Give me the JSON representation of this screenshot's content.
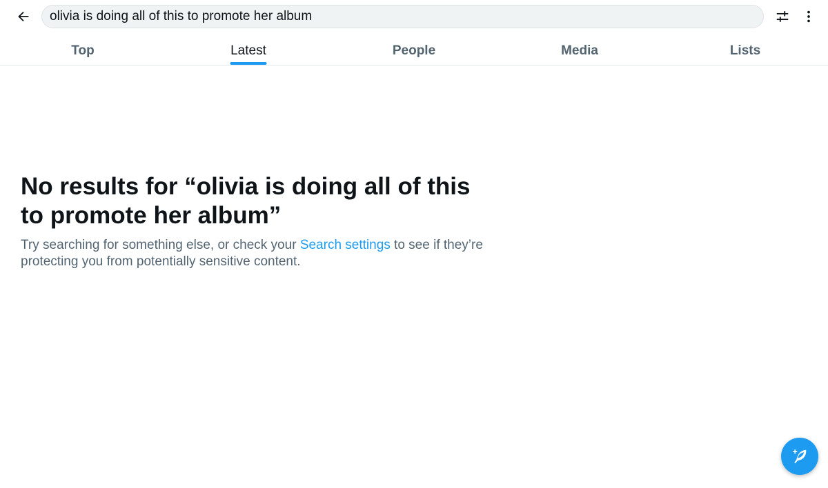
{
  "search": {
    "query": "olivia is doing all of this to promote her album"
  },
  "tabs": [
    {
      "label": "Top",
      "active": false
    },
    {
      "label": "Latest",
      "active": true
    },
    {
      "label": "People",
      "active": false
    },
    {
      "label": "Media",
      "active": false
    },
    {
      "label": "Lists",
      "active": false
    }
  ],
  "empty_state": {
    "title": "No results for “olivia is doing all of this to promote her album”",
    "body_before": "Try searching for something else, or check your ",
    "link_text": "Search settings",
    "body_after": " to see if they’re protecting you from potentially sensitive content."
  },
  "icons": {
    "back": "back-arrow-icon",
    "filter": "sliders-icon",
    "more": "more-vertical-icon",
    "compose": "compose-feather-icon"
  },
  "colors": {
    "accent": "#1d9bf0",
    "text_primary": "#0f1419",
    "text_secondary": "#536471"
  }
}
